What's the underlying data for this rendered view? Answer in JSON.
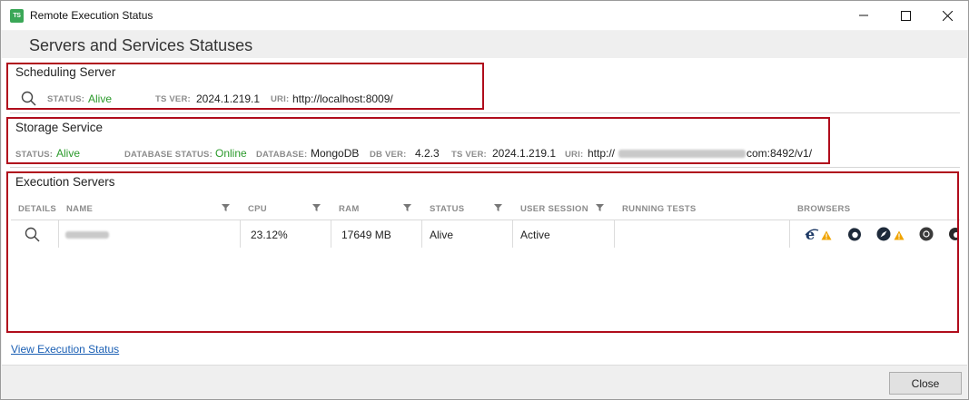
{
  "window": {
    "title": "Remote Execution Status",
    "app_icon_text": "TS"
  },
  "header": {
    "title": "Servers and Services Statuses"
  },
  "scheduling": {
    "title": "Scheduling Server",
    "status_label": "STATUS:",
    "status_value": "Alive",
    "tsver_label": "TS VER:",
    "tsver_value": "2024.1.219.1",
    "uri_label": "URI:",
    "uri_value": "http://localhost:8009/"
  },
  "storage": {
    "title": "Storage Service",
    "status_label": "STATUS:",
    "status_value": "Alive",
    "dbstatus_label": "DATABASE STATUS:",
    "dbstatus_value": "Online",
    "db_label": "DATABASE:",
    "db_value": "MongoDB",
    "dbver_label": "DB VER:",
    "dbver_value": "4.2.3",
    "tsver_label": "TS VER:",
    "tsver_value": "2024.1.219.1",
    "uri_label": "URI:",
    "uri_prefix": "http://",
    "uri_suffix": "com:8492/v1/"
  },
  "execution": {
    "title": "Execution Servers",
    "columns": {
      "details": "DETAILS",
      "name": "NAME",
      "cpu": "CPU",
      "ram": "RAM",
      "status": "STATUS",
      "user_session": "USER SESSION",
      "running_tests": "RUNNING TESTS",
      "browsers": "BROWSERS"
    },
    "rows": [
      {
        "cpu": "23.12%",
        "ram": "17649 MB",
        "status": "Alive",
        "user_session": "Active",
        "running_tests": "",
        "browsers": [
          "ie-icon",
          "firefox-icon",
          "safari-icon",
          "chrome-icon",
          "edge-icon"
        ]
      }
    ]
  },
  "links": {
    "view_execution_status": "View Execution Status"
  },
  "footer": {
    "close_label": "Close"
  },
  "colors": {
    "alive": "#2b9a2b",
    "highlight_border": "#b00d1c",
    "warning": "#f0a400"
  }
}
